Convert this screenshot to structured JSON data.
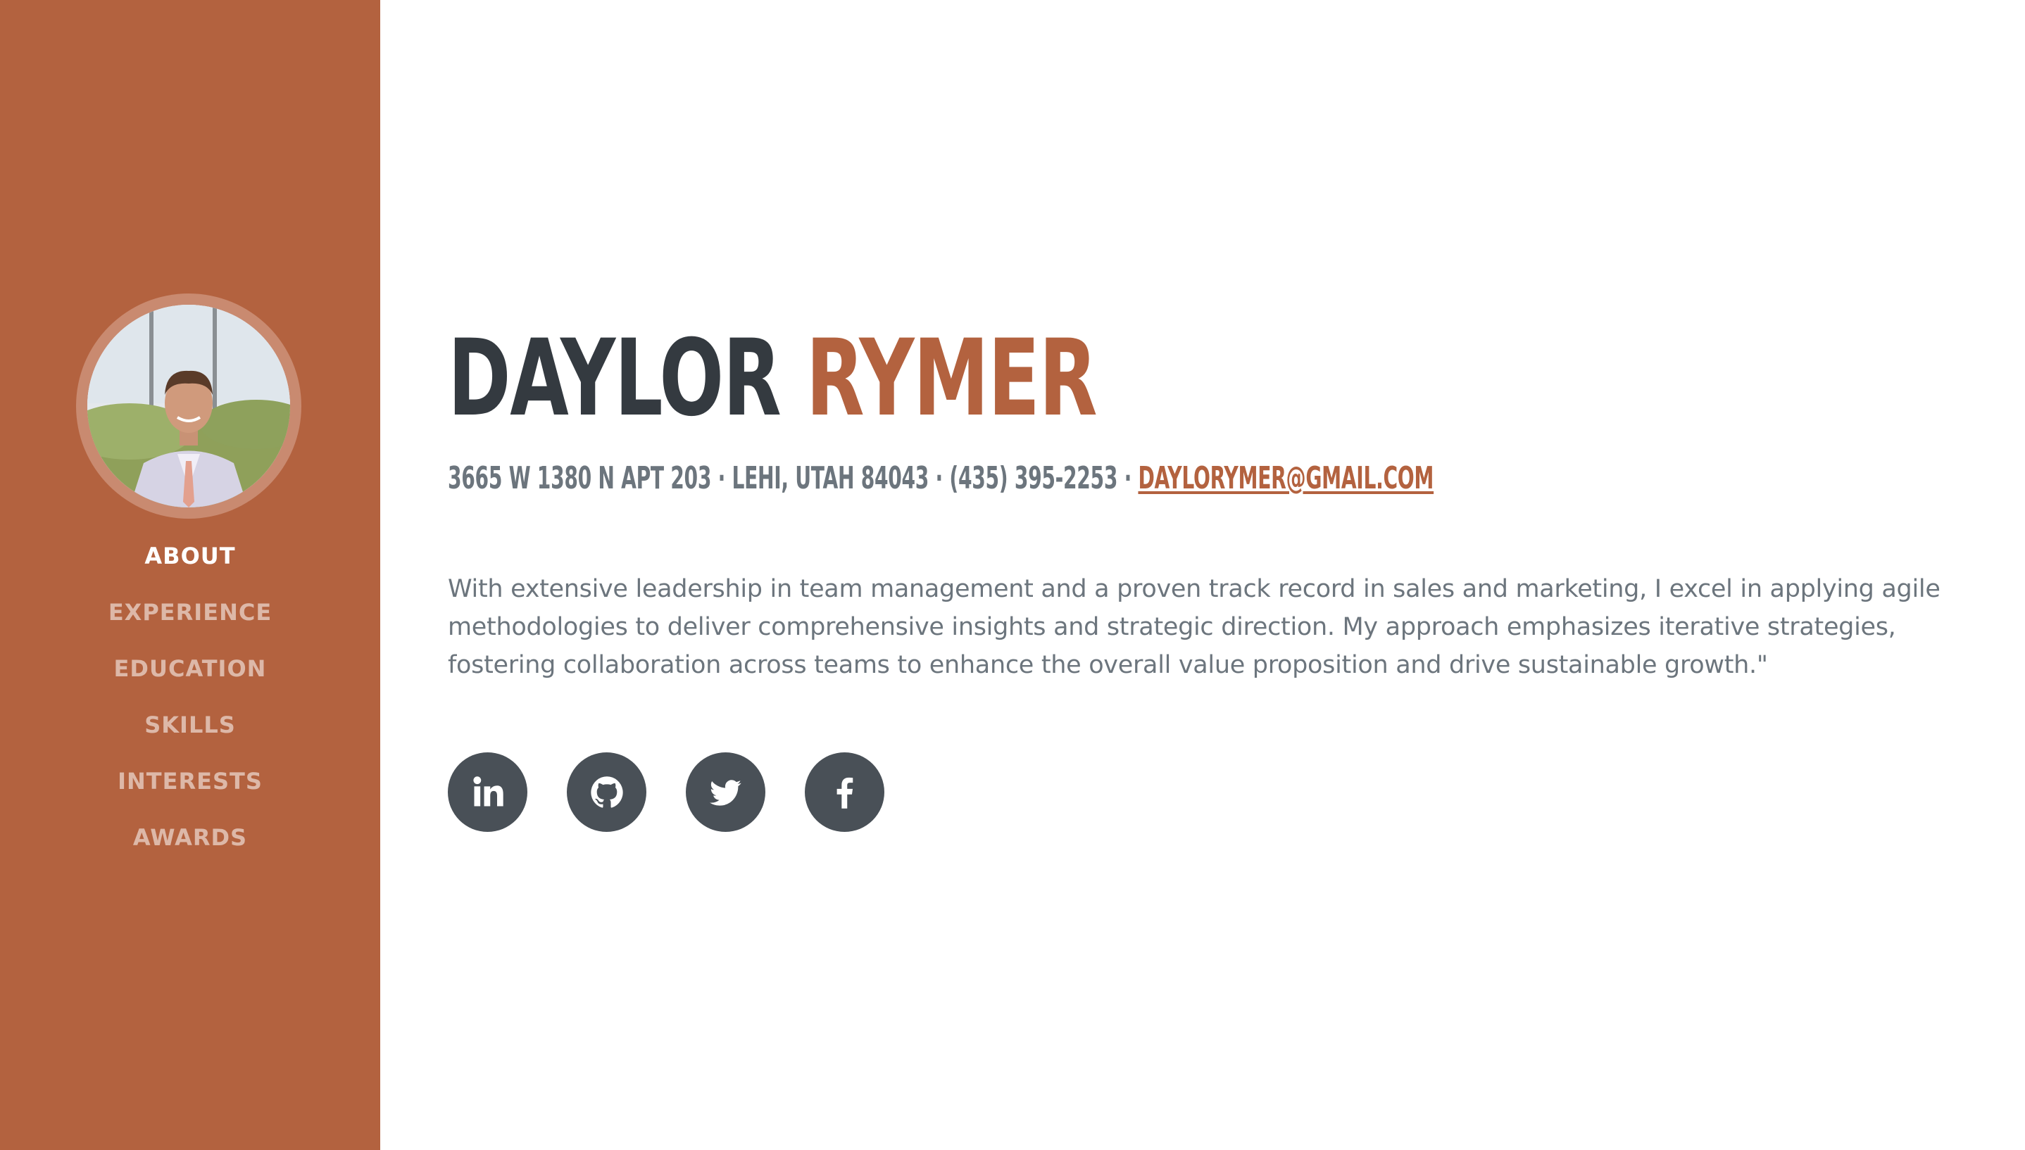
{
  "profile": {
    "first_name": "DAYLOR",
    "last_name": "RYMER",
    "avatar_alt": "profile photo"
  },
  "contact": {
    "address": "3665 W 1380 N APT 203 · LEHI, UTAH 84043 · (435) 395-2253 ·",
    "email": "DAYLORYMER@GMAIL.COM"
  },
  "bio": "With extensive leadership in team management and a proven track record in sales and marketing, I excel in applying agile methodologies to deliver comprehensive insights and strategic direction. My approach emphasizes iterative strategies, fostering collaboration across teams to enhance the overall value proposition and drive sustainable growth.\"",
  "nav": {
    "items": [
      {
        "label": "ABOUT",
        "active": true
      },
      {
        "label": "EXPERIENCE",
        "active": false
      },
      {
        "label": "EDUCATION",
        "active": false
      },
      {
        "label": "SKILLS",
        "active": false
      },
      {
        "label": "INTERESTS",
        "active": false
      },
      {
        "label": "AWARDS",
        "active": false
      }
    ]
  },
  "social": {
    "icons": [
      "linkedin-icon",
      "github-icon",
      "twitter-icon",
      "facebook-icon"
    ]
  },
  "colors": {
    "sidebar": "#b3623f",
    "accent": "#b3623f",
    "heading": "#343a40",
    "text": "#6c757d",
    "social_bg": "#495057"
  }
}
